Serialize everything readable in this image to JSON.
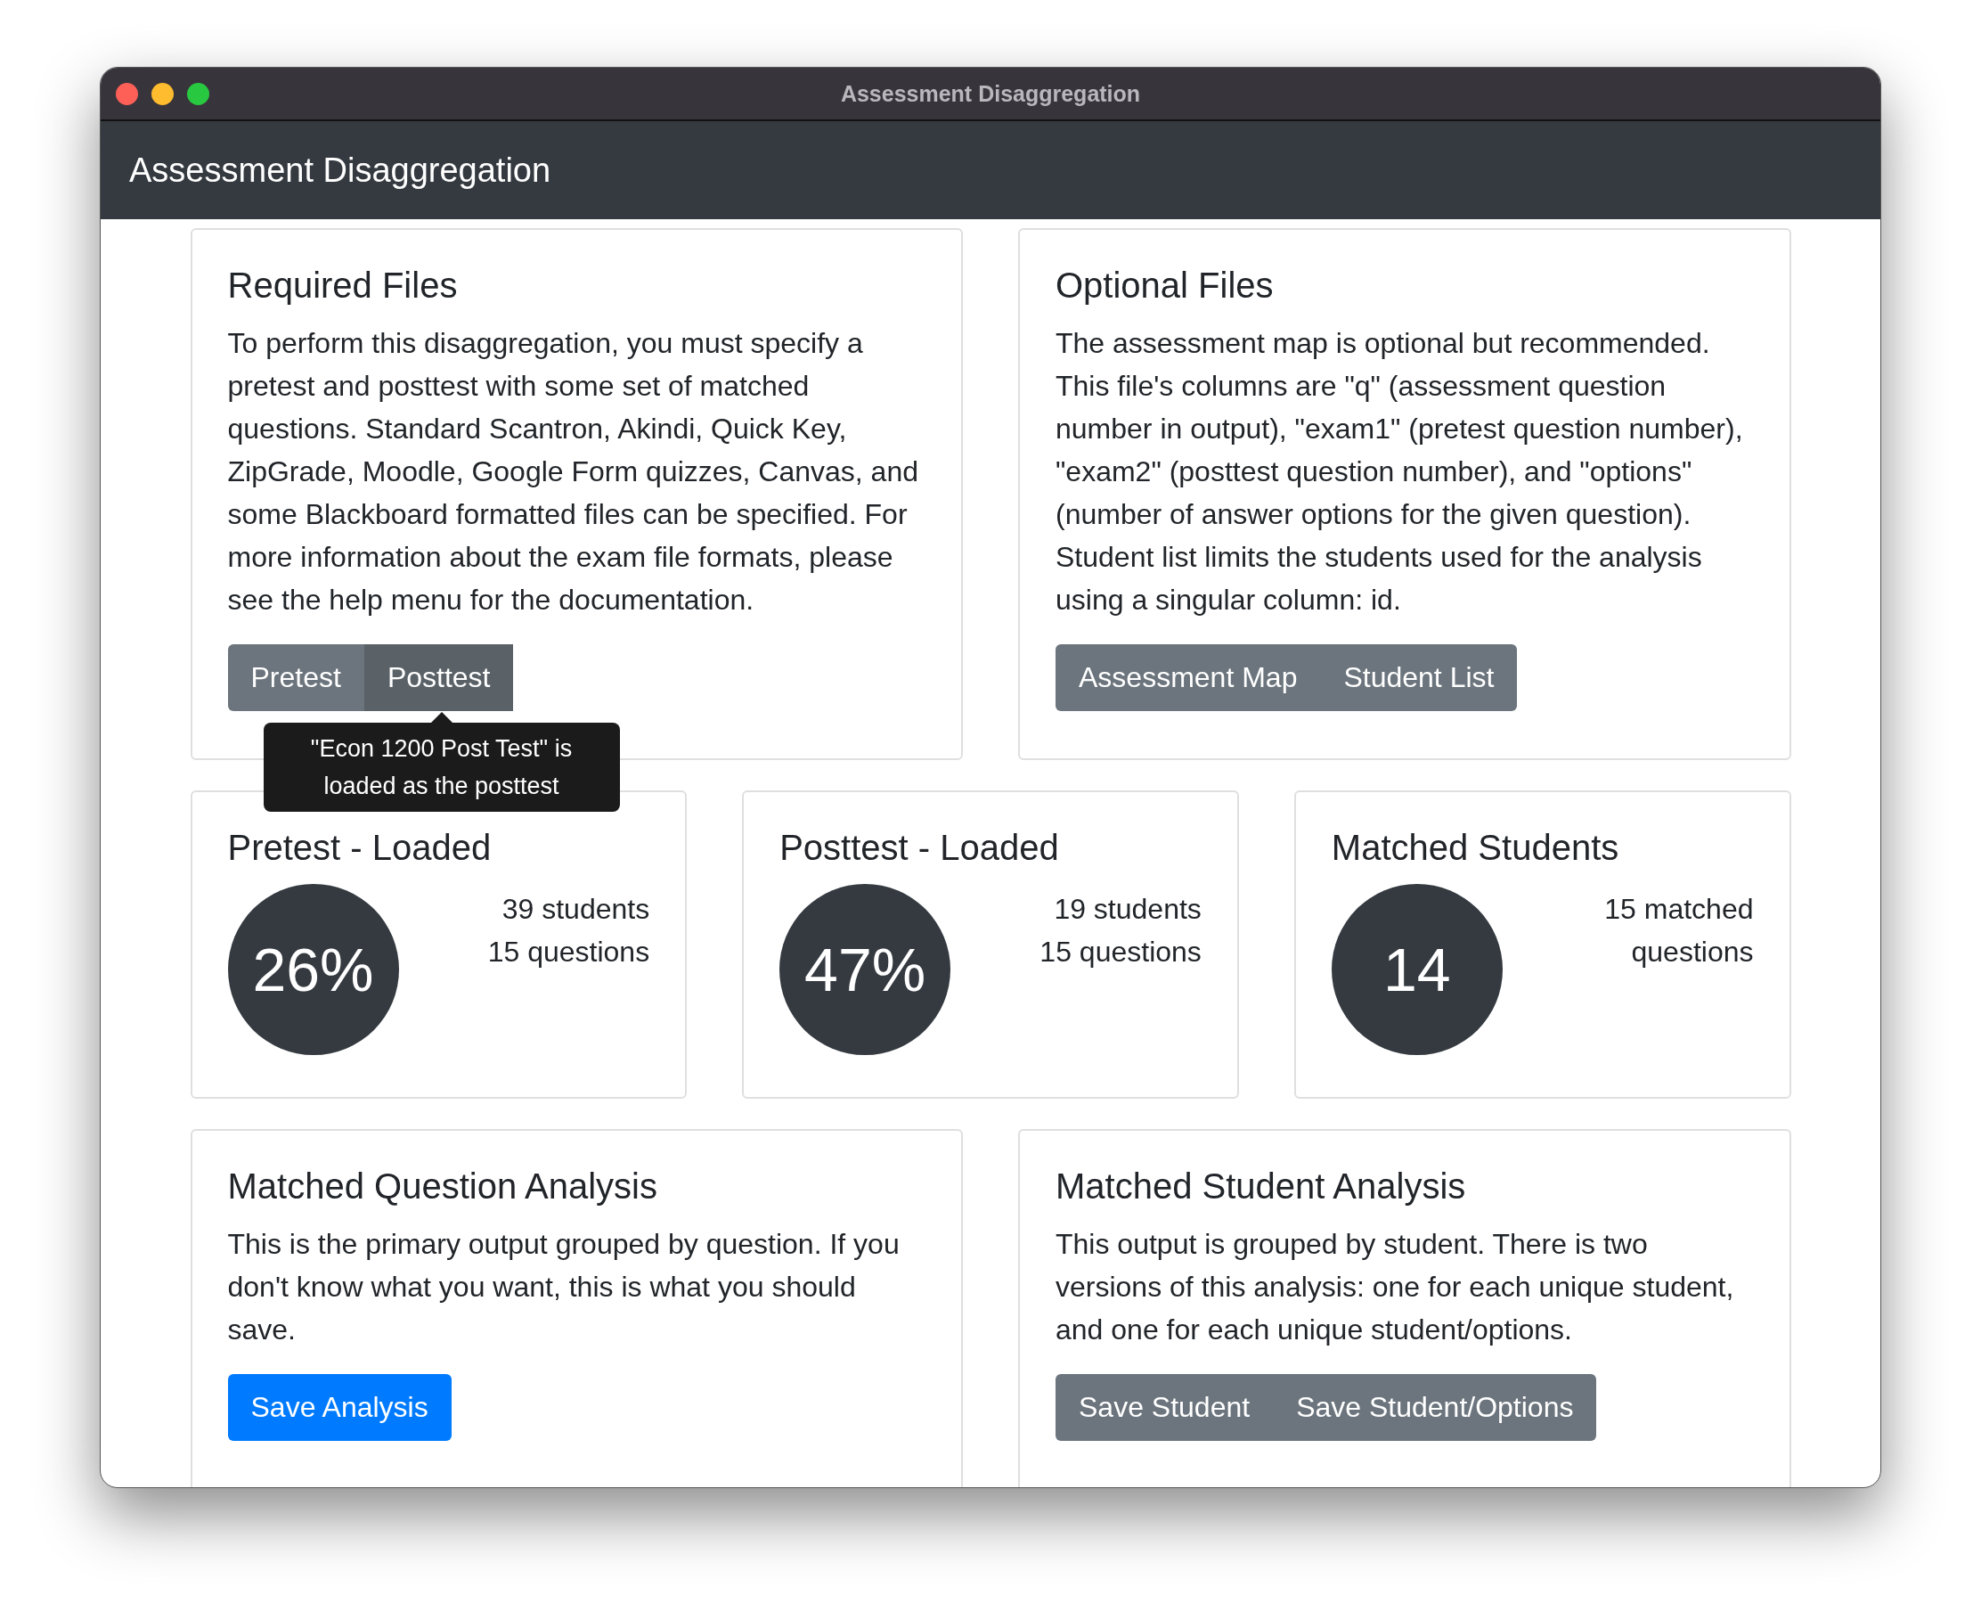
{
  "window": {
    "title": "Assessment Disaggregation"
  },
  "navbar": {
    "title": "Assessment Disaggregation"
  },
  "file_cards": [
    {
      "title": "Required Files",
      "text": "To perform this disaggregation, you must specify a pretest and posttest with some set of matched questions. Standard Scantron, Akindi, Quick Key, ZipGrade, Moodle, Google Form quizzes, Canvas, and some Blackboard formatted files can be specified. For more information about the exam file formats, please see the help menu for the documentation.",
      "buttons": [
        {
          "label": "Pretest",
          "hovered": false
        },
        {
          "label": "Posttest",
          "hovered": true,
          "tooltip": "\"Econ 1200 Post Test\" is loaded as the posttest"
        }
      ]
    },
    {
      "title": "Optional Files",
      "text": "The assessment map is optional but recommended. This file's columns are \"q\" (assessment question number in output), \"exam1\" (pretest question number), \"exam2\" (posttest question number), and \"options\" (number of answer options for the given question). Student list limits the students used for the analysis using a singular column: id.",
      "buttons": [
        {
          "label": "Assessment Map",
          "hovered": false
        },
        {
          "label": "Student List",
          "hovered": false
        }
      ]
    }
  ],
  "stat_cards": [
    {
      "title": "Pretest - Loaded",
      "value": "26%",
      "lines": [
        "39 students",
        "15 questions"
      ]
    },
    {
      "title": "Posttest - Loaded",
      "value": "47%",
      "lines": [
        "19 students",
        "15 questions"
      ]
    },
    {
      "title": "Matched Students",
      "value": "14",
      "lines": [
        "15 matched",
        "questions"
      ]
    }
  ],
  "output_cards": [
    {
      "title": "Matched Question Analysis",
      "text": "This is the primary output grouped by question. If you don't know what you want, this is what you should save.",
      "buttons": [
        {
          "label": "Save Analysis",
          "kind": "primary"
        }
      ]
    },
    {
      "title": "Matched Student Analysis",
      "text": "This output is grouped by student. There is two versions of this analysis: one for each unique student, and one for each unique student/options.",
      "buttons": [
        {
          "label": "Save Student",
          "kind": "secondary"
        },
        {
          "label": "Save Student/Options",
          "kind": "secondary"
        }
      ]
    }
  ]
}
